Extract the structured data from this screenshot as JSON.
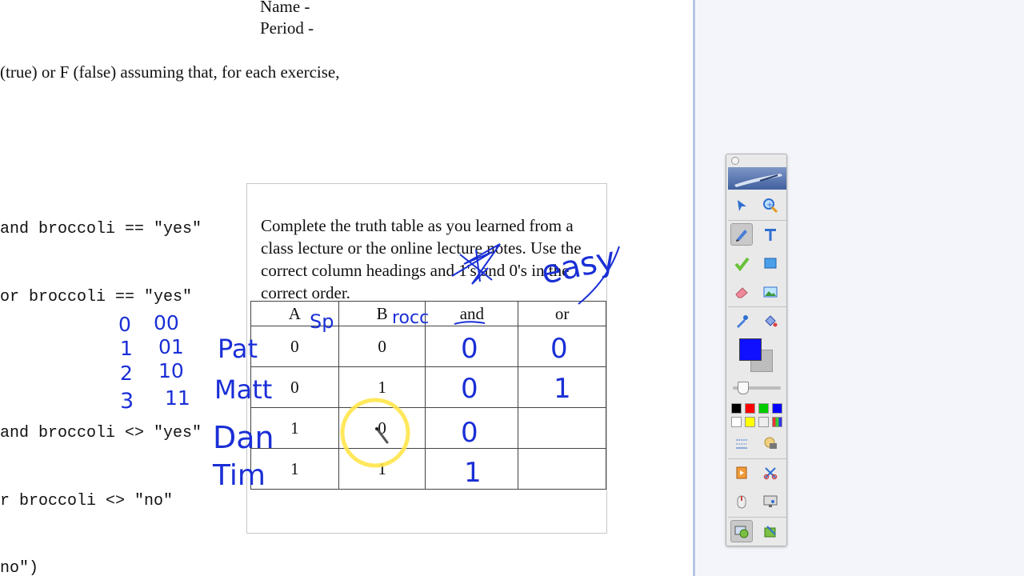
{
  "document": {
    "header_name": "Name -",
    "header_period": "Period -",
    "instruction_fragment": "(true) or F (false) assuming that, for each exercise,",
    "code_lines": [
      "and broccoli == \"yes\"",
      "or broccoli == \"yes\"",
      "and broccoli <> \"yes\"",
      "r broccoli <> \"no\"",
      "no\")"
    ]
  },
  "popup": {
    "instructions": "Complete the truth table as you learned from a class lecture or the online lecture notes. Use the correct column headings and 1's and 0's in the correct order.",
    "table": {
      "headers": [
        "A",
        "B",
        "and",
        "or"
      ],
      "rows": [
        [
          "0",
          "0"
        ],
        [
          "0",
          "1"
        ],
        [
          "1",
          "0"
        ],
        [
          "1",
          "1"
        ]
      ]
    }
  },
  "annotations": {
    "header_notes": [
      "Sp",
      "rocc"
    ],
    "easy_note": "easy",
    "and_column": [
      "0",
      "0",
      "0",
      "1"
    ],
    "or_column": [
      "0",
      "1"
    ],
    "names": [
      "Pat",
      "Matt",
      "Dan",
      "Tim"
    ],
    "decimal_counts": [
      "0",
      "1",
      "2",
      "3"
    ],
    "binary_counts": [
      "00",
      "01",
      "10",
      "11"
    ]
  },
  "toolbar": {
    "current_color": "#1010ff",
    "palette": [
      "#000000",
      "#ff0000",
      "#00cc00",
      "#0000ff",
      "#ffffff",
      "#ffff00",
      "#dddddd",
      "#cccccc"
    ]
  },
  "colors": {
    "ink": "#1a2fd6",
    "highlight": "#ffe64a",
    "divider": "#b7c6e3"
  }
}
